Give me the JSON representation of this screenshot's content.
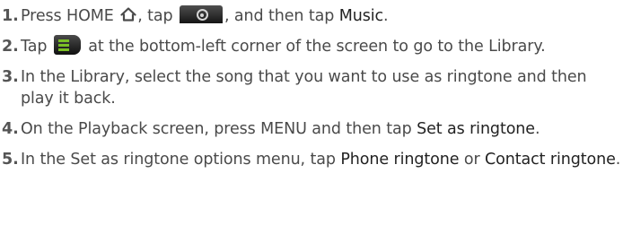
{
  "steps": [
    {
      "number": "1.",
      "parts": {
        "t1": "Press HOME ",
        "t2": ", tap ",
        "t3": ", and then tap ",
        "music": "Music",
        "t4": "."
      },
      "icons": [
        "home-icon",
        "all-apps-icon"
      ]
    },
    {
      "number": "2.",
      "parts": {
        "t1": "Tap ",
        "t2": " at the bottom-left corner of the screen to go to the Library."
      },
      "icons": [
        "library-icon"
      ]
    },
    {
      "number": "3.",
      "text": "In the Library, select the song that you want to use as ringtone and then play it back."
    },
    {
      "number": "4.",
      "parts": {
        "t1": "On the Playback screen, press MENU and then tap ",
        "set_as_ringtone": "Set as ringtone",
        "t2": "."
      }
    },
    {
      "number": "5.",
      "parts": {
        "t1": "In the Set as ringtone options menu, tap ",
        "phone_ringtone": "Phone ringtone",
        "t2": " or ",
        "contact_ringtone": "Contact ringtone",
        "t3": "."
      }
    }
  ],
  "colors": {
    "text": "#4a4a4a",
    "accent_green": "#7bbf25"
  }
}
